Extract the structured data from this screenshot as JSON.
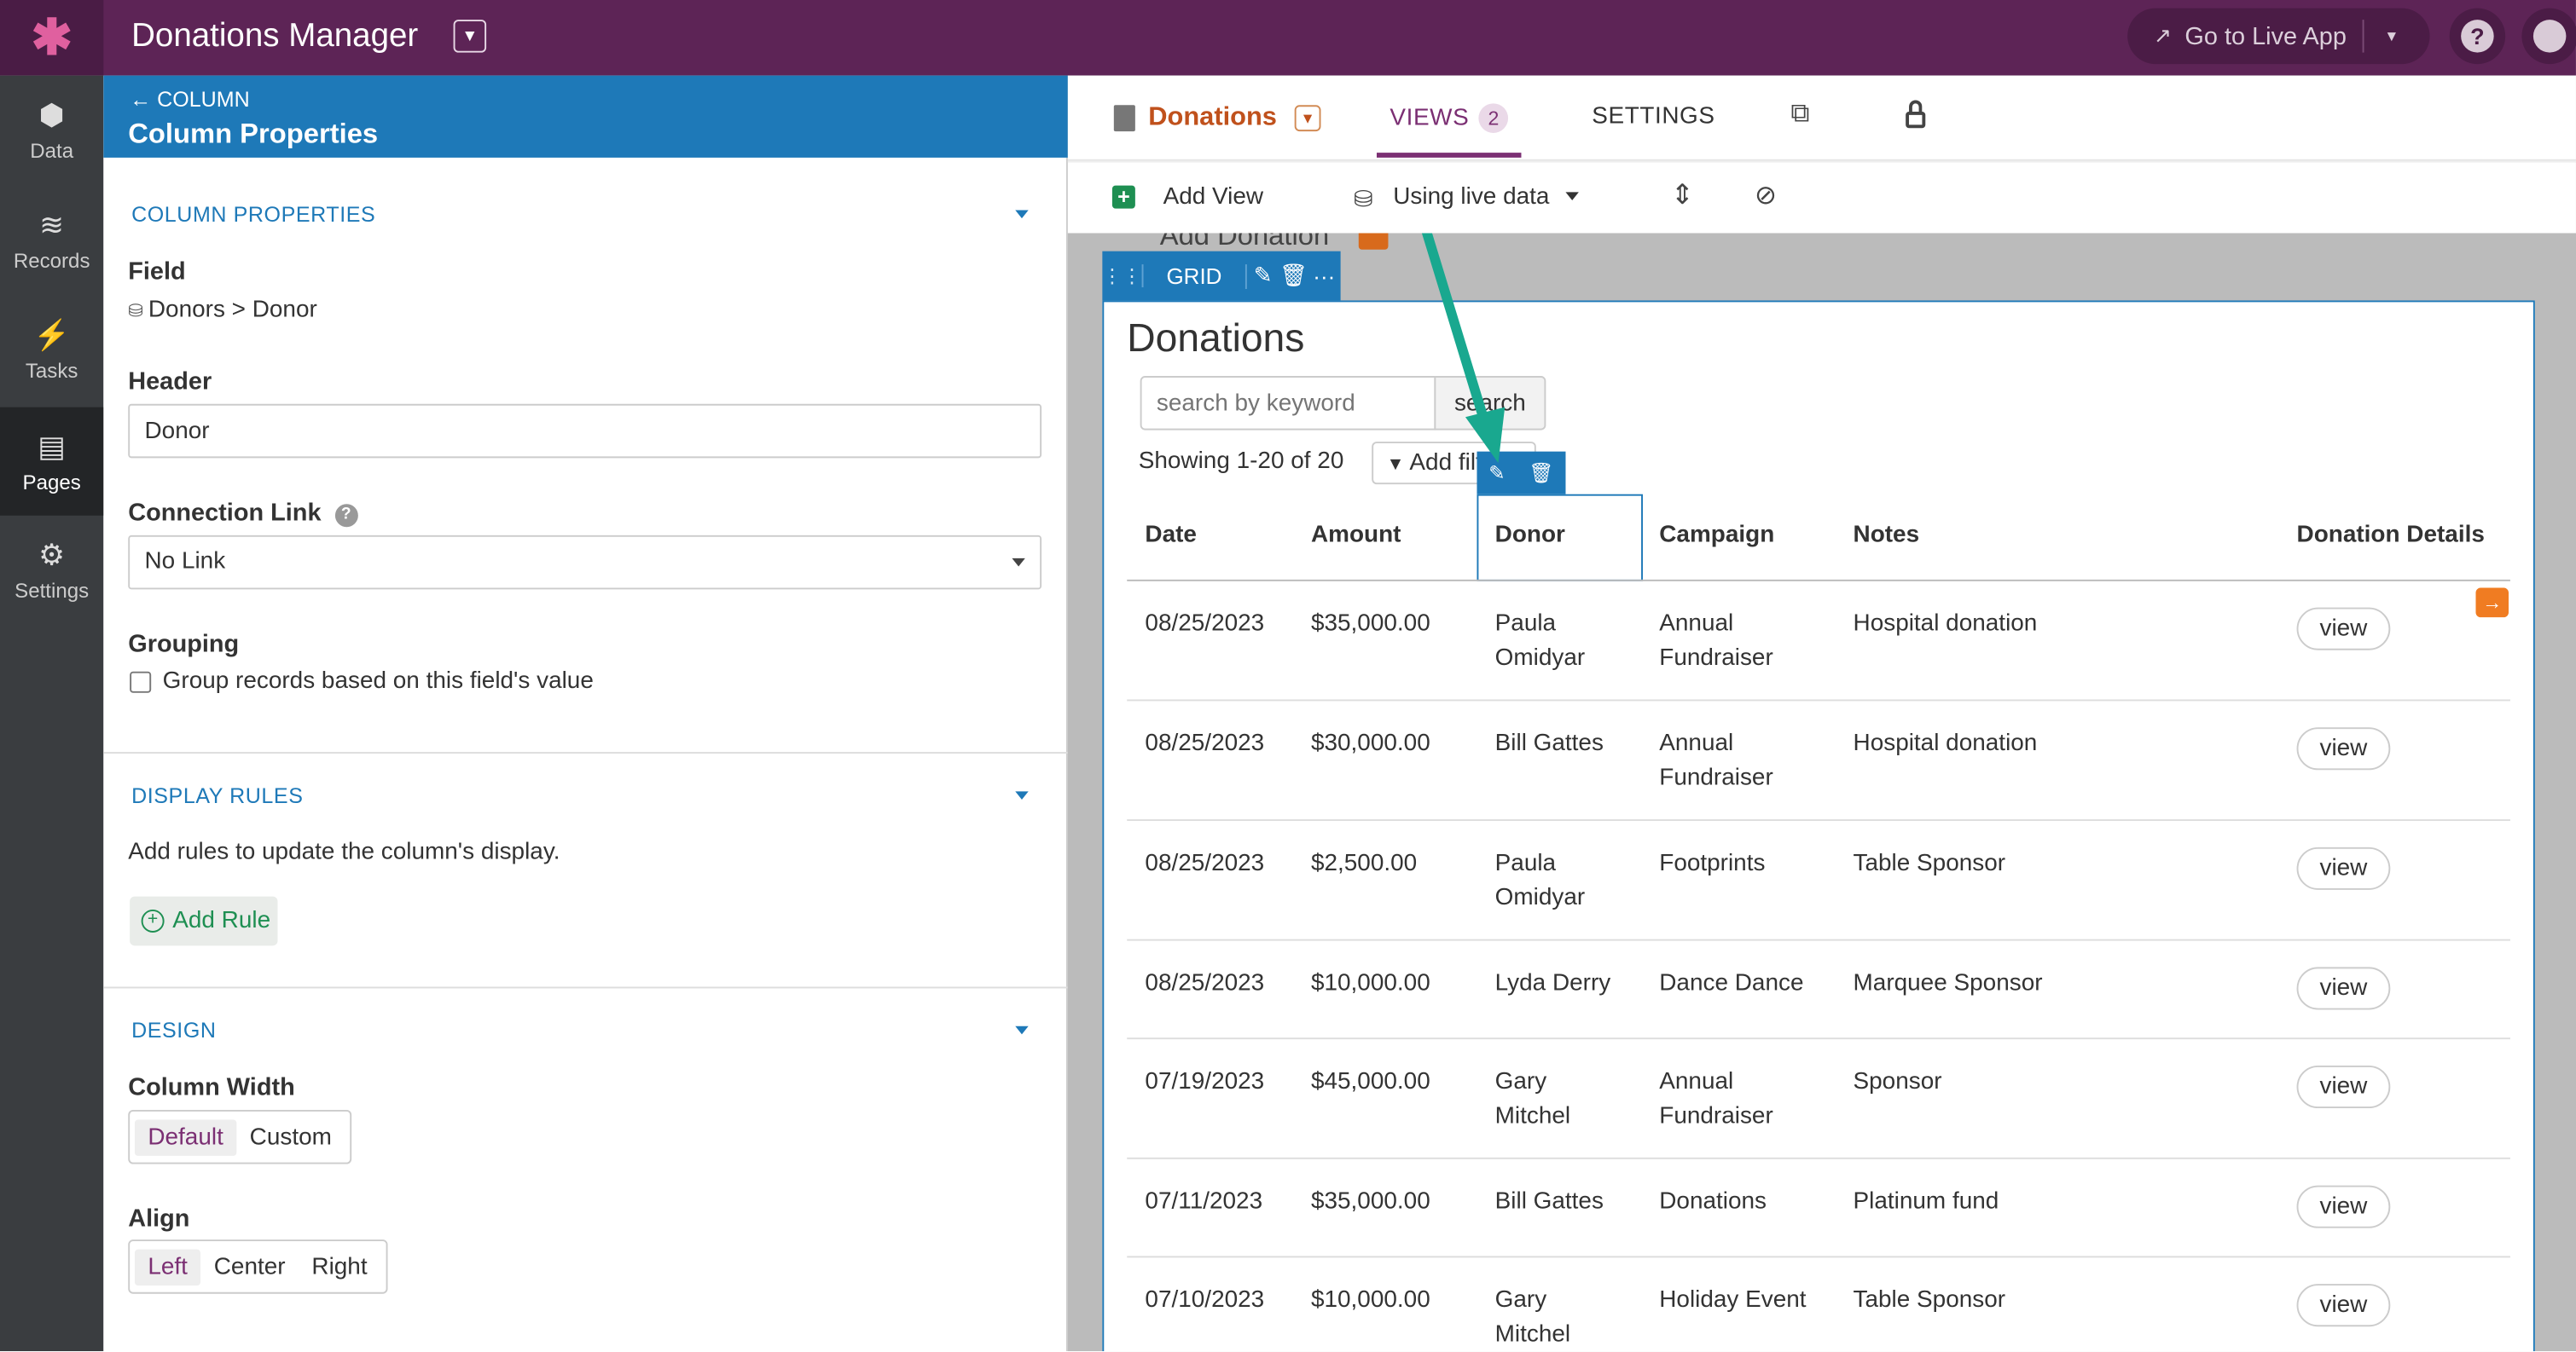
{
  "topbar": {
    "logo": "✱",
    "app_title": "Donations Manager",
    "live_app_label": "Go to Live App"
  },
  "leftnav": [
    {
      "label": "Data",
      "icon": "data-icon",
      "glyph": "⬢"
    },
    {
      "label": "Records",
      "icon": "records-icon",
      "glyph": "≋"
    },
    {
      "label": "Tasks",
      "icon": "bolt-icon",
      "glyph": "⚡"
    },
    {
      "label": "Pages",
      "icon": "pages-icon",
      "glyph": "▤"
    },
    {
      "label": "Settings",
      "icon": "gear-icon",
      "glyph": "⚙"
    }
  ],
  "panel": {
    "back_label": "COLUMN",
    "title": "Column Properties",
    "column_properties": {
      "heading": "COLUMN PROPERTIES",
      "field_label": "Field",
      "field_value": "Donors > Donor",
      "header_label": "Header",
      "header_value": "Donor",
      "connection_label": "Connection Link",
      "connection_value": "No Link",
      "grouping_label": "Grouping",
      "grouping_option": "Group records based on this field's value"
    },
    "display_rules": {
      "heading": "DISPLAY RULES",
      "description": "Add rules to update the column's display.",
      "add_rule_label": "Add Rule"
    },
    "design": {
      "heading": "DESIGN",
      "width_label": "Column Width",
      "width_options": [
        "Default",
        "Custom"
      ],
      "align_label": "Align",
      "align_options": [
        "Left",
        "Center",
        "Right"
      ]
    }
  },
  "builder": {
    "page_name": "Donations",
    "tab_views": "VIEWS",
    "views_count": "2",
    "tab_settings": "SETTINGS",
    "add_view_label": "Add View",
    "data_mode_label": "Using live data",
    "bg_button": "Add Donation",
    "grid_label": "GRID"
  },
  "view": {
    "title": "Donations",
    "search_placeholder": "search by keyword",
    "search_button": "search",
    "showing": "Showing 1-20 of 20",
    "add_filter": "Add filters",
    "columns": [
      "Date",
      "Amount",
      "Donor",
      "Campaign",
      "Notes",
      "Donation Details"
    ],
    "view_label": "view",
    "rows": [
      {
        "date": "08/25/2023",
        "amount": "$35,000.00",
        "donor1": "Paula",
        "donor2": "Omidyar",
        "camp1": "Annual",
        "camp2": "Fundraiser",
        "notes": "Hospital donation"
      },
      {
        "date": "08/25/2023",
        "amount": "$30,000.00",
        "donor1": "Bill Gattes",
        "donor2": "",
        "camp1": "Annual",
        "camp2": "Fundraiser",
        "notes": "Hospital donation"
      },
      {
        "date": "08/25/2023",
        "amount": "$2,500.00",
        "donor1": "Paula",
        "donor2": "Omidyar",
        "camp1": "Footprints",
        "camp2": "",
        "notes": "Table Sponsor"
      },
      {
        "date": "08/25/2023",
        "amount": "$10,000.00",
        "donor1": "Lyda Derry",
        "donor2": "",
        "camp1": "Dance Dance",
        "camp2": "",
        "notes": "Marquee Sponsor"
      },
      {
        "date": "07/19/2023",
        "amount": "$45,000.00",
        "donor1": "Gary",
        "donor2": "Mitchel",
        "camp1": "Annual",
        "camp2": "Fundraiser",
        "notes": "Sponsor"
      },
      {
        "date": "07/11/2023",
        "amount": "$35,000.00",
        "donor1": "Bill Gattes",
        "donor2": "",
        "camp1": "Donations",
        "camp2": "",
        "notes": "Platinum fund"
      },
      {
        "date": "07/10/2023",
        "amount": "$10,000.00",
        "donor1": "Gary",
        "donor2": "Mitchel",
        "camp1": "Holiday Event",
        "camp2": "",
        "notes": "Table Sponsor"
      }
    ]
  },
  "colors": {
    "topbar": "#5d2456",
    "panel_header": "#1e79b8",
    "accent_purple": "#7b2f73",
    "orange": "#c0511c",
    "annotation_arrow": "#19a88f"
  }
}
